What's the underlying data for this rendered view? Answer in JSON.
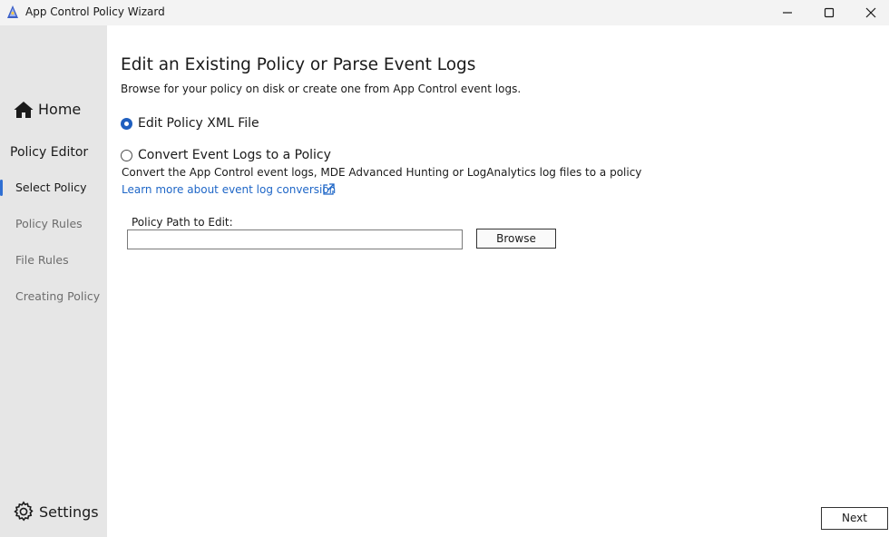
{
  "window": {
    "title": "App Control Policy Wizard",
    "controls": [
      "minimize-icon",
      "maximize-icon",
      "close-icon"
    ]
  },
  "sidebar": {
    "home_label": "Home",
    "section_label": "Policy Editor",
    "items": [
      {
        "label": "Select Policy",
        "active": true
      },
      {
        "label": "Policy Rules",
        "active": false
      },
      {
        "label": "File Rules",
        "active": false
      },
      {
        "label": "Creating Policy",
        "active": false
      }
    ],
    "settings_label": "Settings"
  },
  "main": {
    "title": "Edit an Existing Policy or Parse Event Logs",
    "subtitle": "Browse for your policy on disk or create one from App Control event logs.",
    "options": [
      {
        "label": "Edit Policy XML File",
        "checked": true
      },
      {
        "label": "Convert Event Logs to a Policy",
        "checked": false
      }
    ],
    "convert_description": "Convert the App Control event logs, MDE Advanced Hunting or LogAnalytics log files to a policy",
    "learn_more_link": "Learn more about event log conversion",
    "path_label": "Policy Path to Edit:",
    "path_value": "",
    "browse_label": "Browse",
    "next_label": "Next"
  },
  "colors": {
    "accent": "#1f5fbf",
    "link": "#1e66c7",
    "sidebar_bg": "#e6e6e6",
    "titlebar_bg": "#f3f3f3"
  }
}
